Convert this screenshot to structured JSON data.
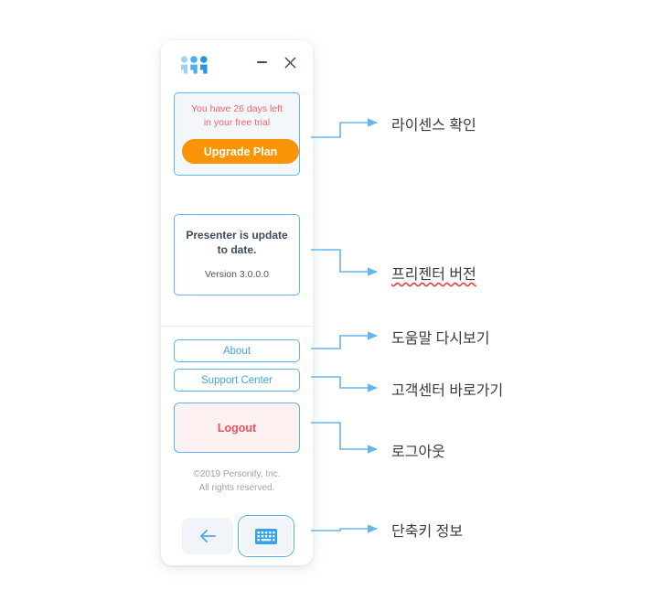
{
  "window": {
    "logo_name": "personify-logo",
    "minimize_label": "–",
    "close_label": "×"
  },
  "trial": {
    "line1": "You have 26 days left",
    "line2": "in your free trial",
    "upgrade_label": "Upgrade Plan",
    "accent_color": "#f89406",
    "text_color": "#f4616a",
    "border_color": "#64b5ef"
  },
  "version": {
    "status": "Presenter is update to date.",
    "version_label": "Version 3.0.0.0"
  },
  "actions": {
    "about_label": "About",
    "support_label": "Support Center",
    "logout_label": "Logout",
    "logout_color": "#f4505a"
  },
  "copyright": {
    "line1": "©2019 Personify, Inc.",
    "line2": "All rights reserved."
  },
  "bottom_bar": {
    "back_icon": "back-arrow-icon",
    "keyboard_icon": "keyboard-icon"
  },
  "annotations": [
    {
      "id": "license-check",
      "text": "라이센스 확인",
      "misspelled": false
    },
    {
      "id": "presenter-version",
      "text": "프리젠터 버전",
      "misspelled": true
    },
    {
      "id": "help-review",
      "text": "도움말 다시보기",
      "misspelled": false
    },
    {
      "id": "support-shortcut",
      "text": "고객센터 바로가기",
      "misspelled": false
    },
    {
      "id": "logout",
      "text": "로그아웃",
      "misspelled": false
    },
    {
      "id": "shortcut-info",
      "text": "단축키 정보",
      "misspelled": false
    }
  ],
  "connector_color": "#66b6ec"
}
